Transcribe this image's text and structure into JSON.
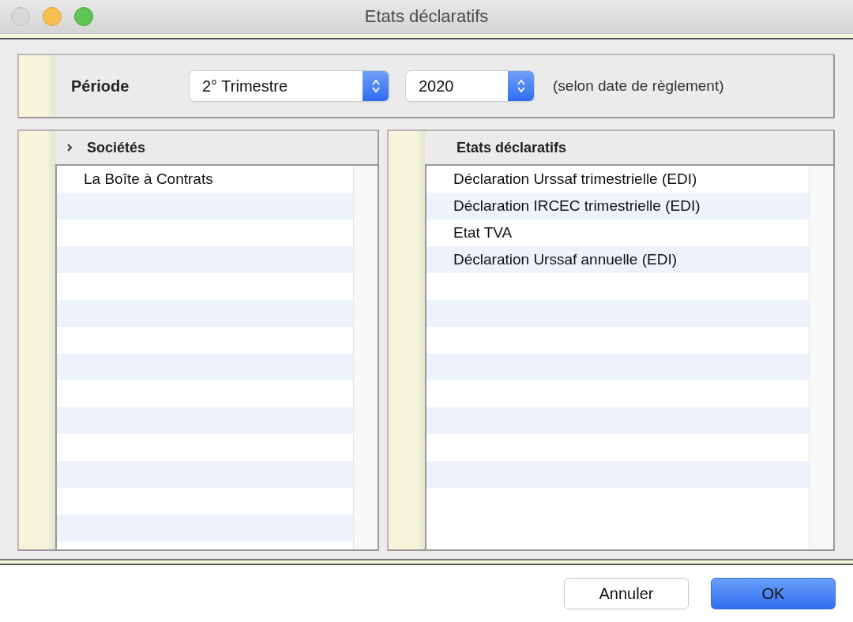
{
  "window": {
    "title": "Etats déclaratifs"
  },
  "period": {
    "label": "Période",
    "quarter": "2° Trimestre",
    "year": "2020",
    "note": "(selon date de règlement)"
  },
  "companies": {
    "header": "Sociétés",
    "rows": [
      "La Boîte à Contrats"
    ]
  },
  "statements": {
    "header": "Etats déclaratifs",
    "rows": [
      "Déclaration Urssaf trimestrielle (EDI)",
      "Déclaration IRCEC trimestrielle (EDI)",
      "Etat TVA",
      "Déclaration Urssaf annuelle (EDI)"
    ]
  },
  "buttons": [
    {
      "label": "Annuler",
      "kind": "secondary"
    },
    {
      "label": "OK",
      "kind": "primary"
    }
  ]
}
